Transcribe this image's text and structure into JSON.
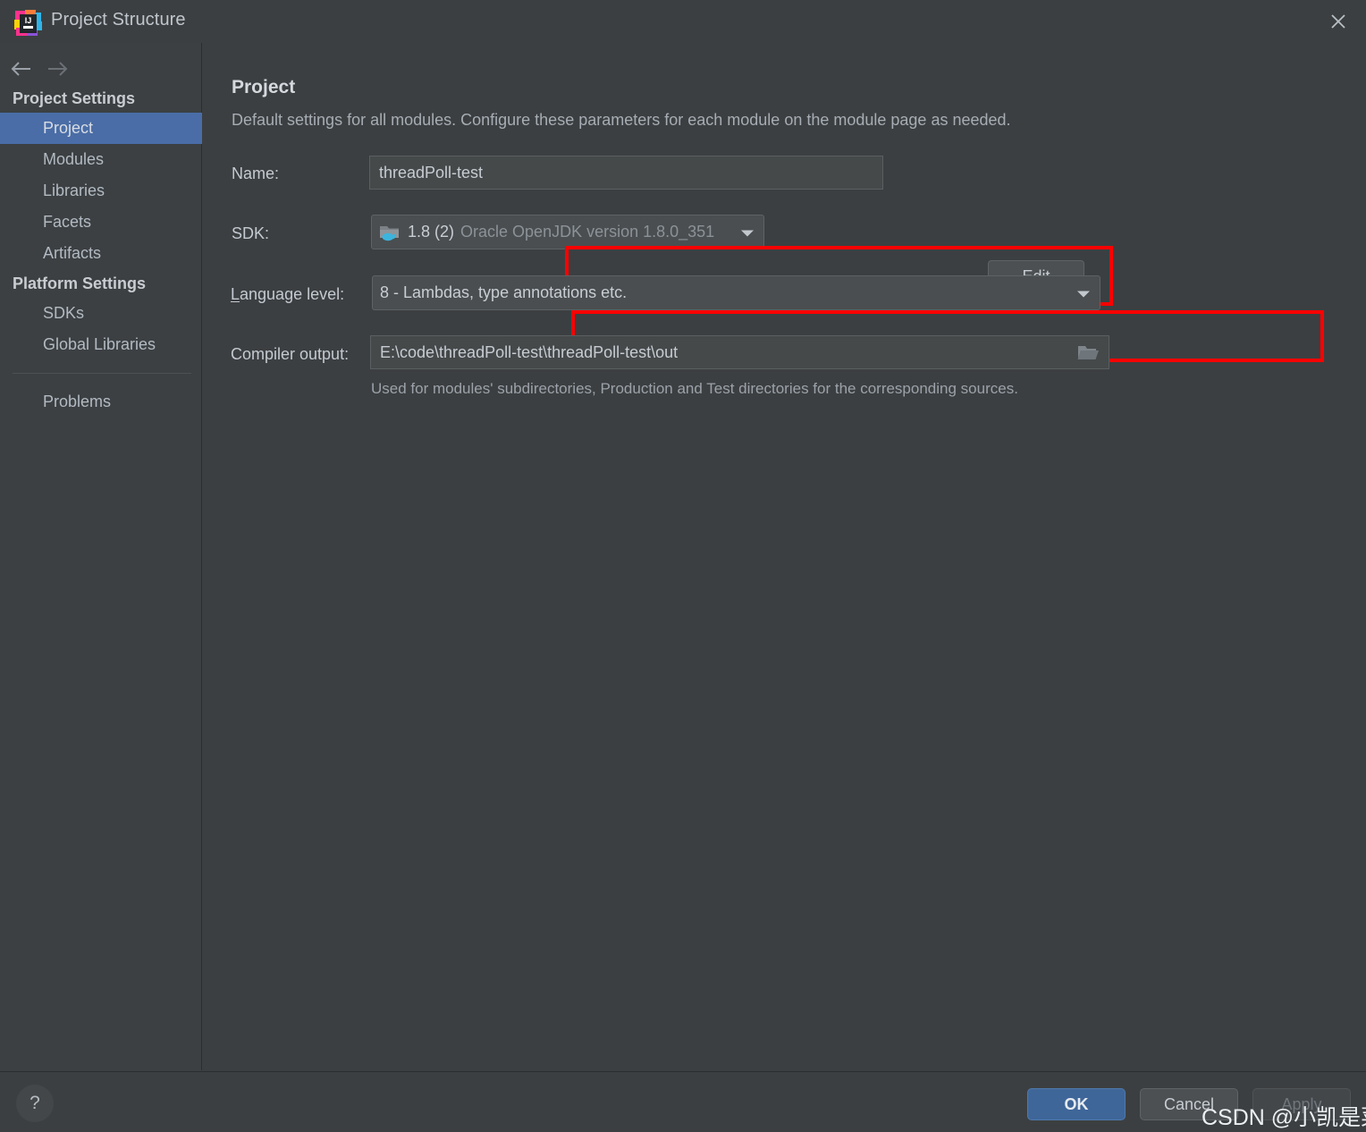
{
  "window": {
    "title": "Project Structure",
    "app_icon": "intellij-idea-logo",
    "close_icon": "close-icon"
  },
  "sidebar": {
    "nav": {
      "back_icon": "arrow-left-icon",
      "forward_icon": "arrow-right-icon"
    },
    "groups": [
      {
        "title": "Project Settings",
        "items": [
          {
            "label": "Project",
            "selected": true
          },
          {
            "label": "Modules",
            "selected": false
          },
          {
            "label": "Libraries",
            "selected": false
          },
          {
            "label": "Facets",
            "selected": false
          },
          {
            "label": "Artifacts",
            "selected": false
          }
        ]
      },
      {
        "title": "Platform Settings",
        "items": [
          {
            "label": "SDKs",
            "selected": false
          },
          {
            "label": "Global Libraries",
            "selected": false
          }
        ]
      }
    ],
    "extra_items": [
      {
        "label": "Problems",
        "selected": false
      }
    ]
  },
  "main": {
    "heading": "Project",
    "description": "Default settings for all modules. Configure these parameters for each module on the module page as needed.",
    "name_label": "Name:",
    "name_value": "threadPoll-test",
    "sdk_label": "SDK:",
    "sdk_icon": "jdk-folder-icon",
    "sdk_value": "1.8 (2)",
    "sdk_value_secondary": "Oracle OpenJDK version 1.8.0_351",
    "sdk_dropdown_icon": "chevron-down-icon",
    "edit_button": "Edit",
    "edit_mnemonic": "E",
    "edit_rest": "dit",
    "language_level_mnemonic": "L",
    "language_level_label_rest": "anguage level:",
    "language_level_value": "8 - Lambdas, type annotations etc.",
    "language_level_dropdown_icon": "chevron-down-icon",
    "compiler_output_label": "Compiler output:",
    "compiler_output_value": "E:\\code\\threadPoll-test\\threadPoll-test\\out",
    "compiler_output_browse_icon": "open-folder-icon",
    "compiler_output_hint": "Used for modules' subdirectories, Production and Test directories for the corresponding sources."
  },
  "annotations": {
    "highlight_color": "#fe0000",
    "boxes": [
      "sdk-row-highlight",
      "language-level-row-highlight"
    ]
  },
  "footer": {
    "help_icon": "help-question-icon",
    "ok_label": "OK",
    "cancel_label": "Cancel",
    "apply_label": "Apply"
  },
  "watermark": {
    "text": "CSDN @小凯是菜鸡"
  },
  "colors": {
    "window_bg": "#3c3f41",
    "sidebar_bg": "#3c4043",
    "selection_blue": "#4a6da7",
    "primary_button": "#3f6699",
    "highlight_red": "#fe0000"
  }
}
